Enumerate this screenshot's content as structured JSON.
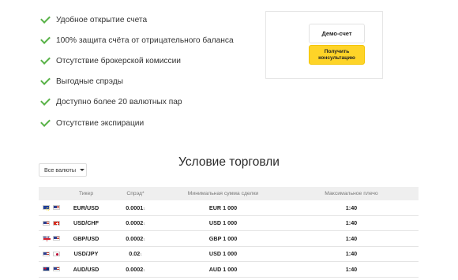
{
  "features": [
    "Удобное открытие счета",
    "100% защита счёта от отрицательного баланса",
    "Отсутствие брокерской комиссии",
    "Выгодные спрэды",
    "Доступно более 20 валютных пар",
    "Отсутствие экспирации"
  ],
  "cta": {
    "demo_label": "Демо-счет",
    "consult_label": "Получить консультацию",
    "consult_color": "#fed428"
  },
  "section": {
    "title": "Условие торговли",
    "filter_label": "Все валюты"
  },
  "table": {
    "headers": {
      "ticker": "Тикер",
      "spread": "Спрэд*",
      "min": "Минимальная сумма сделки",
      "leverage": "Максимальное плечо"
    },
    "rows": [
      {
        "flags": [
          "eu-flag-icon",
          "us-flag-icon"
        ],
        "ticker": "EUR/USD",
        "spread": "0.0001",
        "spread_suffix": "1",
        "min": "EUR 1 000",
        "leverage": "1:40"
      },
      {
        "flags": [
          "us-flag-icon",
          "ch-flag-icon"
        ],
        "ticker": "USD/CHF",
        "spread": "0.0002",
        "spread_suffix": "1",
        "min": "USD 1 000",
        "leverage": "1:40"
      },
      {
        "flags": [
          "gb-flag-icon",
          "us-flag-icon"
        ],
        "ticker": "GBP/USD",
        "spread": "0.0002",
        "spread_suffix": "1",
        "min": "GBP 1 000",
        "leverage": "1:40"
      },
      {
        "flags": [
          "us-flag-icon",
          "jp-flag-icon"
        ],
        "ticker": "USD/JPY",
        "spread": "0.02",
        "spread_suffix": "1",
        "min": "USD 1 000",
        "leverage": "1:40"
      },
      {
        "flags": [
          "au-flag-icon",
          "us-flag-icon"
        ],
        "ticker": "AUD/USD",
        "spread": "0.0002",
        "spread_suffix": "1",
        "min": "AUD 1 000",
        "leverage": "1:40"
      }
    ]
  },
  "colors": {
    "check": "#58b247",
    "header_bg": "#efefef"
  }
}
